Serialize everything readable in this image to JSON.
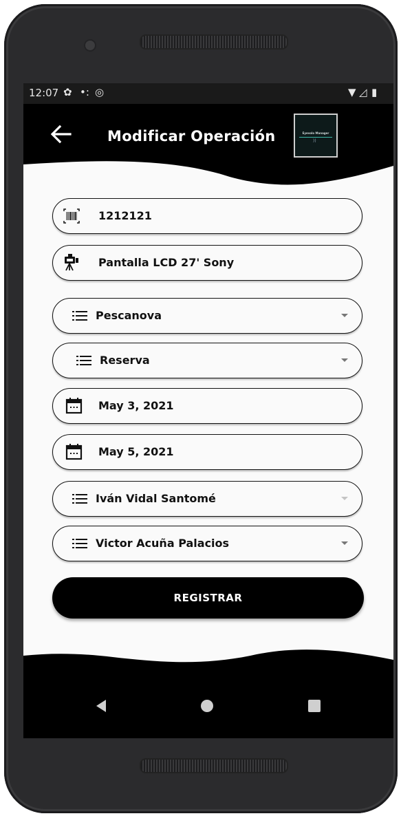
{
  "status_bar": {
    "time": "12:07"
  },
  "app_bar": {
    "title": "Modificar Operación",
    "logo_text": "Eyevolo Manager"
  },
  "form": {
    "barcode_value": "1212121",
    "product_value": "Pantalla LCD 27' Sony",
    "client_select": "Pescanova",
    "type_select": "Reserva",
    "start_date": "May 3, 2021",
    "end_date": "May 5, 2021",
    "employee_select": "Iván Vidal Santomé",
    "responsible_select": "Victor Acuña Palacios"
  },
  "actions": {
    "register_label": "REGISTRAR"
  },
  "colors": {
    "primary": "#000000",
    "background": "#fafafa",
    "text": "#111111"
  }
}
